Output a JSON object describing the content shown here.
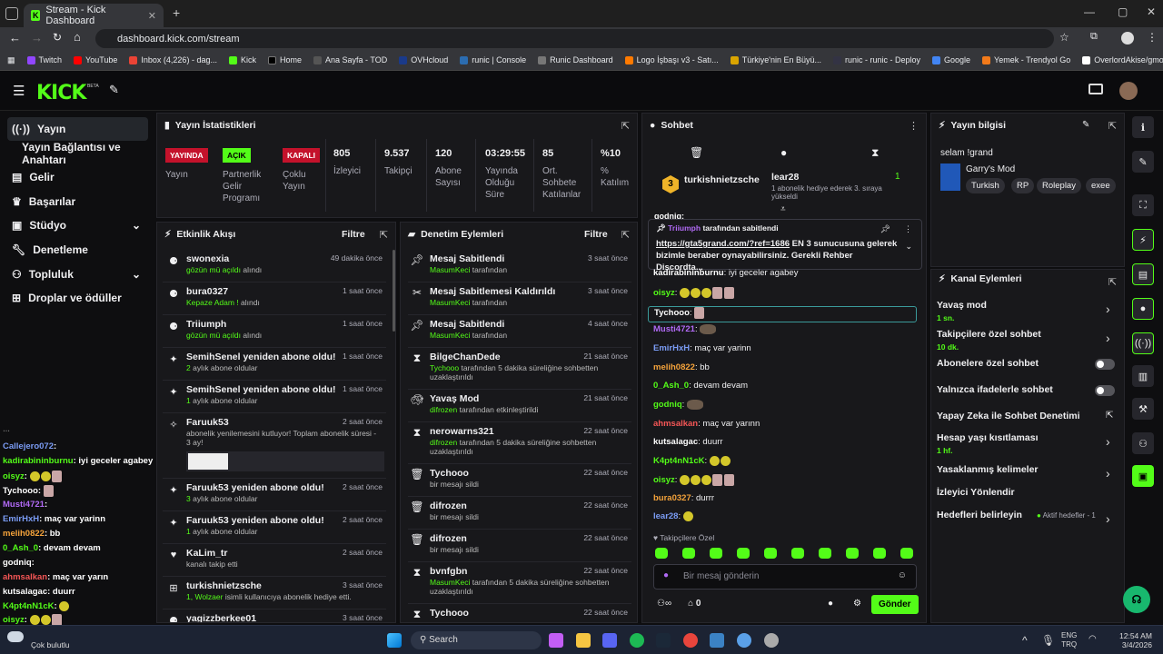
{
  "browser": {
    "tab_title": "Stream - Kick Dashboard",
    "url": "dashboard.kick.com/stream",
    "bookmarks": [
      "Twitch",
      "YouTube",
      "Inbox (4,226) - dag...",
      "Kick",
      "Home",
      "Ana Sayfa - TOD",
      "OVHcloud",
      "runic | Console",
      "Runic Dashboard",
      "Logo İşbaşı v3 - Satı...",
      "Türkiye'nin En Büyü...",
      "runic - runic - Deploy",
      "Google",
      "Yemek - Trendyol Go",
      "OverlordAkise/gmo..."
    ]
  },
  "header": {
    "logo": "KICK",
    "beta": "BETA"
  },
  "nav": {
    "items": [
      "Yayın",
      "Yayın Bağlantısı ve Anahtarı",
      "Gelir",
      "Başarılar",
      "Stüdyo",
      "Denetleme",
      "Topluluk",
      "Droplar ve ödüller"
    ]
  },
  "stats": {
    "title": "Yayın İstatistikleri",
    "items": [
      {
        "value": "YAYINDA",
        "label": "Yayın"
      },
      {
        "value": "AÇIK",
        "label": "Partnerlik Gelir Programı"
      },
      {
        "value": "KAPALI",
        "label": "Çoklu Yayın"
      },
      {
        "value": "805",
        "label": "İzleyici"
      },
      {
        "value": "9.537",
        "label": "Takipçi"
      },
      {
        "value": "120",
        "label": "Abone Sayısı"
      },
      {
        "value": "03:29:55",
        "label": "Yayında Olduğu Süre"
      },
      {
        "value": "85",
        "label": "Ort. Sohbete Katılanlar"
      },
      {
        "value": "%10",
        "label": "% Katılım"
      }
    ]
  },
  "activity": {
    "title": "Etkinlik Akışı",
    "filter": "Filtre",
    "rows": [
      {
        "name": "swonexia",
        "sub_green": "gözün mü açıldı",
        "sub": " alındı",
        "time": "49 dakika önce"
      },
      {
        "name": "bura0327",
        "sub_green": "Kepaze Adam !",
        "sub": " alındı",
        "time": "1 saat önce"
      },
      {
        "name": "Triiumph",
        "sub_green": "gözün mü açıldı",
        "sub": " alındı",
        "time": "1 saat önce"
      },
      {
        "name": "SemihSenel yeniden abone oldu!",
        "sub_green": "2",
        "sub": " aylık abone oldular",
        "time": "1 saat önce"
      },
      {
        "name": "SemihSenel yeniden abone oldu!",
        "sub_green": "1",
        "sub": " aylık abone oldular",
        "time": "1 saat önce"
      },
      {
        "name": "Faruuk53",
        "sub_green": "",
        "sub": "abonelik yenilemesini kutluyor! Toplam abonelik süresi - 3 ay!",
        "time": "2 saat önce"
      },
      {
        "name": "Faruuk53 yeniden abone oldu!",
        "sub_green": "3",
        "sub": " aylık abone oldular",
        "time": "2 saat önce"
      },
      {
        "name": "Faruuk53 yeniden abone oldu!",
        "sub_green": "1",
        "sub": " aylık abone oldular",
        "time": "2 saat önce"
      },
      {
        "name": "KaLim_tr",
        "sub_green": "",
        "sub": "kanalı takip etti",
        "time": "2 saat önce"
      },
      {
        "name": "turkishnietzsche",
        "sub_green": "1, Wolzaer",
        "sub": " isimli kullanıcıya abonelik hediye etti.",
        "time": "3 saat önce"
      },
      {
        "name": "yagizzberkee01",
        "sub_green": "",
        "sub": "",
        "time": "3 saat önce"
      }
    ]
  },
  "moderation": {
    "title": "Denetim Eylemleri",
    "filter": "Filtre",
    "rows": [
      {
        "name": "Mesaj Sabitlendi",
        "sub_green": "MasumKeci",
        "sub": " tarafından",
        "time": "3 saat önce"
      },
      {
        "name": "Mesaj Sabitlemesi Kaldırıldı",
        "sub_green": "MasumKeci",
        "sub": " tarafından",
        "time": "3 saat önce"
      },
      {
        "name": "Mesaj Sabitlendi",
        "sub_green": "MasumKeci",
        "sub": " tarafından",
        "time": "4 saat önce"
      },
      {
        "name": "BilgeChanDede",
        "sub_green": "Tychooo",
        "sub": " tarafından 5 dakika süreliğine sohbetten uzaklaştırıldı",
        "time": "21 saat önce"
      },
      {
        "name": "Yavaş Mod",
        "sub_green": "difrozen",
        "sub": " tarafından etkinleştirildi",
        "time": "21 saat önce"
      },
      {
        "name": "nerowarns321",
        "sub_green": "difrozen",
        "sub": " tarafından 5 dakika süreliğine sohbetten uzaklaştırıldı",
        "time": "22 saat önce"
      },
      {
        "name": "Tychooo",
        "sub_green": "",
        "sub": "bir mesajı sildi",
        "time": "22 saat önce"
      },
      {
        "name": "difrozen",
        "sub_green": "",
        "sub": "bir mesajı sildi",
        "time": "22 saat önce"
      },
      {
        "name": "difrozen",
        "sub_green": "",
        "sub": "bir mesajı sildi",
        "time": "22 saat önce"
      },
      {
        "name": "bvnfgbn",
        "sub_green": "MasumKeci",
        "sub": " tarafından 5 dakika süreliğine sohbetten uzaklaştırıldı",
        "time": "22 saat önce"
      },
      {
        "name": "Tychooo",
        "sub_green": "",
        "sub": "",
        "time": "22 saat önce"
      }
    ]
  },
  "chat": {
    "title": "Sohbet",
    "top_gifter": "turkishnietzsche",
    "top_gifter_count": "3",
    "leader": "lear28",
    "leader_count": "1",
    "leader_sub": "1 abonelik hediye ederek 3. sıraya yükseldi",
    "partial": "godniq:",
    "pinned_by": "Triiumph",
    "pinned_label": "tarafından sabitlendi",
    "pinned_link": "https://gta5grand.com/?ref=1686",
    "pinned_text": " EN 3 sunucusuna gelerek bizimle beraber oynayabilirsiniz. Gerekli Rehber Discordta...",
    "messages": [
      {
        "user": "kadirabininburnu",
        "text": ": iyi geceler agabey"
      },
      {
        "user": "oisyz",
        "text": ":"
      },
      {
        "user": "Tychooo",
        "text": ":"
      },
      {
        "user": "Musti4721",
        "text": ":"
      },
      {
        "user": "EmirHxH",
        "text": ": maç var yarinn"
      },
      {
        "user": "melih0822",
        "text": ": bb"
      },
      {
        "user": "0_Ash_0",
        "text": ": devam devam"
      },
      {
        "user": "godniq",
        "text": ":"
      },
      {
        "user": "ahmsalkan",
        "text": ": maç var yarınn"
      },
      {
        "user": "kutsalagac",
        "text": ": duurr"
      },
      {
        "user": "K4pt4nN1cK",
        "text": ":"
      },
      {
        "user": "oisyz",
        "text": ":"
      },
      {
        "user": "bura0327",
        "text": ": durrr"
      },
      {
        "user": "lear28",
        "text": ":"
      }
    ],
    "emote_section": "Takipçilere Özel",
    "input_placeholder": "Bir mesaj gönderin",
    "points": "0",
    "send": "Gönder"
  },
  "stream_info": {
    "title": "Yayın bilgisi",
    "stream_title": "selam !grand",
    "category": "Garry's Mod",
    "tags": [
      "Turkish",
      "RP",
      "Roleplay",
      "exee"
    ]
  },
  "channel_actions": {
    "title": "Kanal Eylemleri",
    "items": [
      {
        "label": "Yavaş mod",
        "sub": "1 sn."
      },
      {
        "label": "Takipçilere özel sohbet",
        "sub": "10 dk."
      },
      {
        "label": "Abonelere özel sohbet",
        "sub": ""
      },
      {
        "label": "Yalnızca ifadelerle sohbet",
        "sub": ""
      },
      {
        "label": "Yapay Zeka ile Sohbet Denetimi",
        "sub": ""
      },
      {
        "label": "Hesap yaşı kısıtlaması",
        "sub": "1 hf."
      },
      {
        "label": "Yasaklanmış kelimeler",
        "sub": ""
      },
      {
        "label": "İzleyici Yönlendir",
        "sub": ""
      },
      {
        "label": "Hedefleri belirleyin",
        "sub": ""
      }
    ],
    "goals_status": "Aktif hedefler - 1"
  },
  "overlay_chat": [
    {
      "user": "Callejero072",
      "text": ":",
      "color": "#7b9cf5"
    },
    {
      "user": "kadirabininburnu",
      "text": ": iyi geceler agabey",
      "color": "#53fc18"
    },
    {
      "user": "oisyz",
      "text": ":",
      "color": "#53fc18"
    },
    {
      "user": "Tychooo",
      "text": ":",
      "color": "#ffffff"
    },
    {
      "user": "Musti4721",
      "text": ":",
      "color": "#b16af5"
    },
    {
      "user": "EmirHxH",
      "text": ": maç var yarinn",
      "color": "#7b9cf5"
    },
    {
      "user": "melih0822",
      "text": ": bb",
      "color": "#f5a33b"
    },
    {
      "user": "0_Ash_0",
      "text": ": devam devam",
      "color": "#53fc18"
    },
    {
      "user": "godniq",
      "text": ":",
      "color": "#ffffff"
    },
    {
      "user": "ahmsalkan",
      "text": ": maç var yarın",
      "color": "#f55656"
    },
    {
      "user": "kutsalagac",
      "text": ": duurr",
      "color": "#ffffff"
    },
    {
      "user": "K4pt4nN1cK",
      "text": ":",
      "color": "#53fc18"
    },
    {
      "user": "oisyz",
      "text": ":",
      "color": "#53fc18"
    },
    {
      "user": "bura0327",
      "text": ": durrr",
      "color": "#f5a33b"
    }
  ],
  "weather": "Çok bulutlu",
  "taskbar": {
    "search": "Search",
    "lang1": "ENG",
    "lang2": "TRQ",
    "time": "12:54 AM",
    "date": "3/4/2026"
  },
  "colors": {
    "accent": "#53fc18",
    "live": "#c4122b",
    "panel": "#18181b"
  }
}
